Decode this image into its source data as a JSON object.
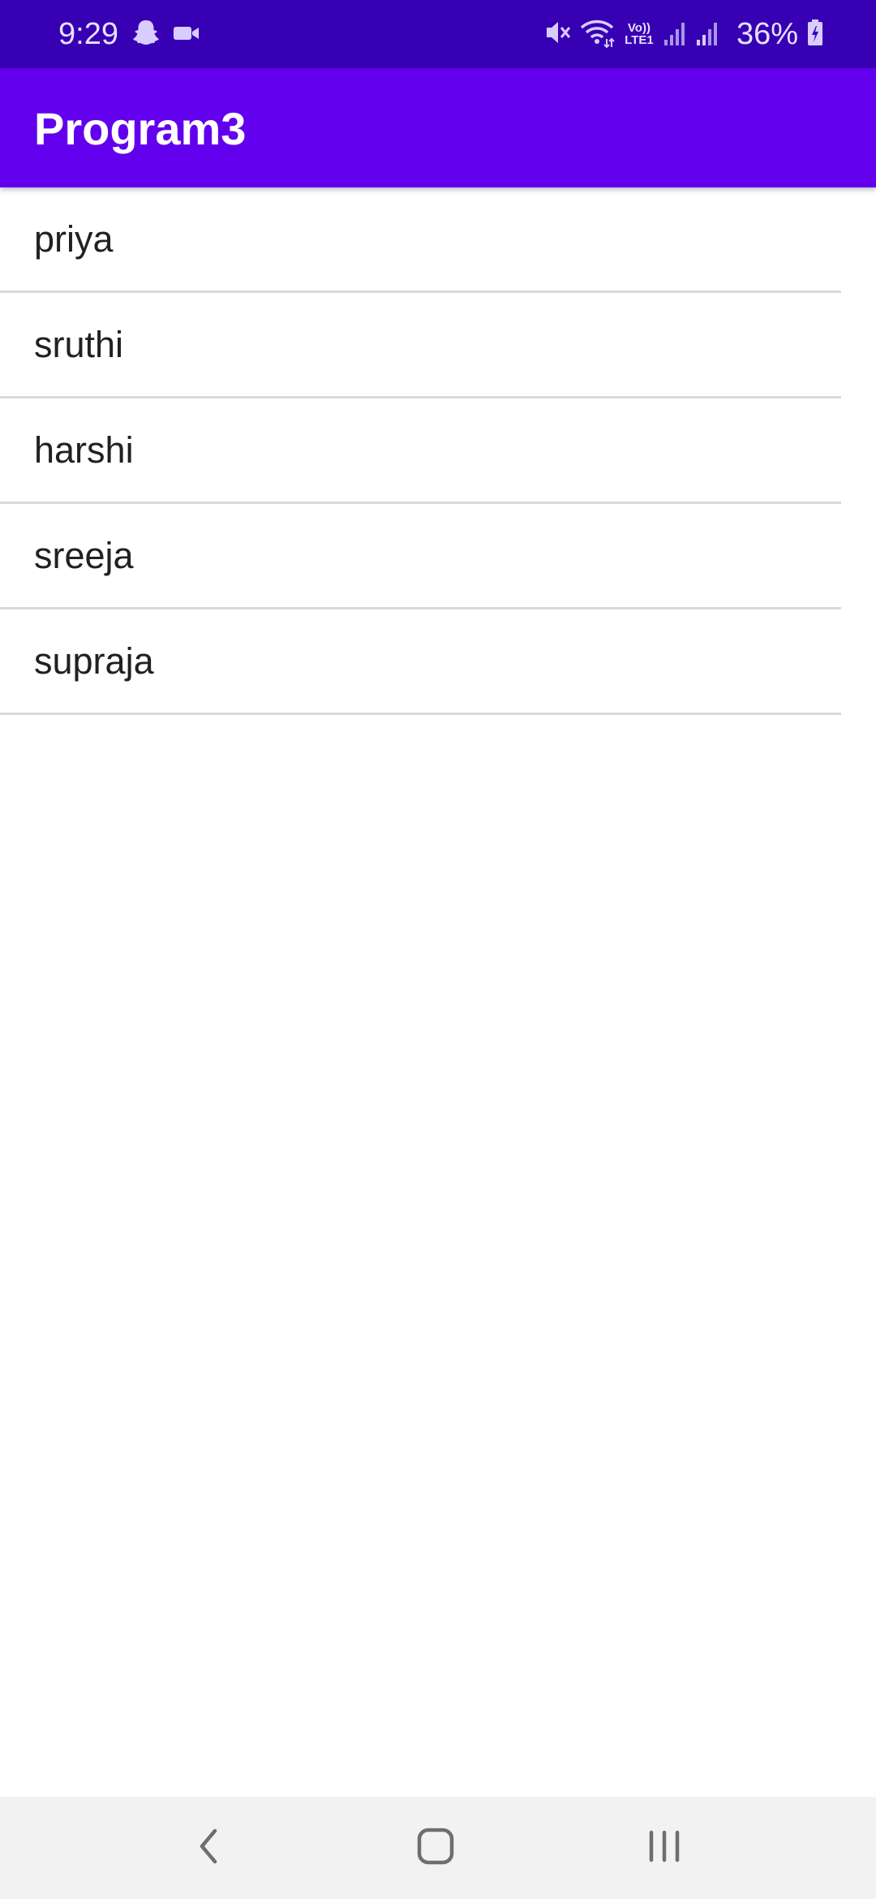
{
  "status_bar": {
    "time": "9:29",
    "battery": "36%",
    "network_label_top": "Vo))",
    "network_label_bottom": "LTE1",
    "left_icons": [
      "snapchat-icon",
      "video-camera-icon"
    ],
    "right_icons": [
      "mute-icon",
      "wifi-icon",
      "signal-icon",
      "signal-icon",
      "battery-icon"
    ],
    "background_color": "#3700b3"
  },
  "app_bar": {
    "title": "Program3",
    "background_color": "#6200ee"
  },
  "list": {
    "items": [
      {
        "label": "priya"
      },
      {
        "label": "sruthi"
      },
      {
        "label": "harshi"
      },
      {
        "label": "sreeja"
      },
      {
        "label": "supraja"
      }
    ]
  },
  "nav_bar": {
    "buttons": [
      "back-icon",
      "home-icon",
      "recents-icon"
    ]
  }
}
